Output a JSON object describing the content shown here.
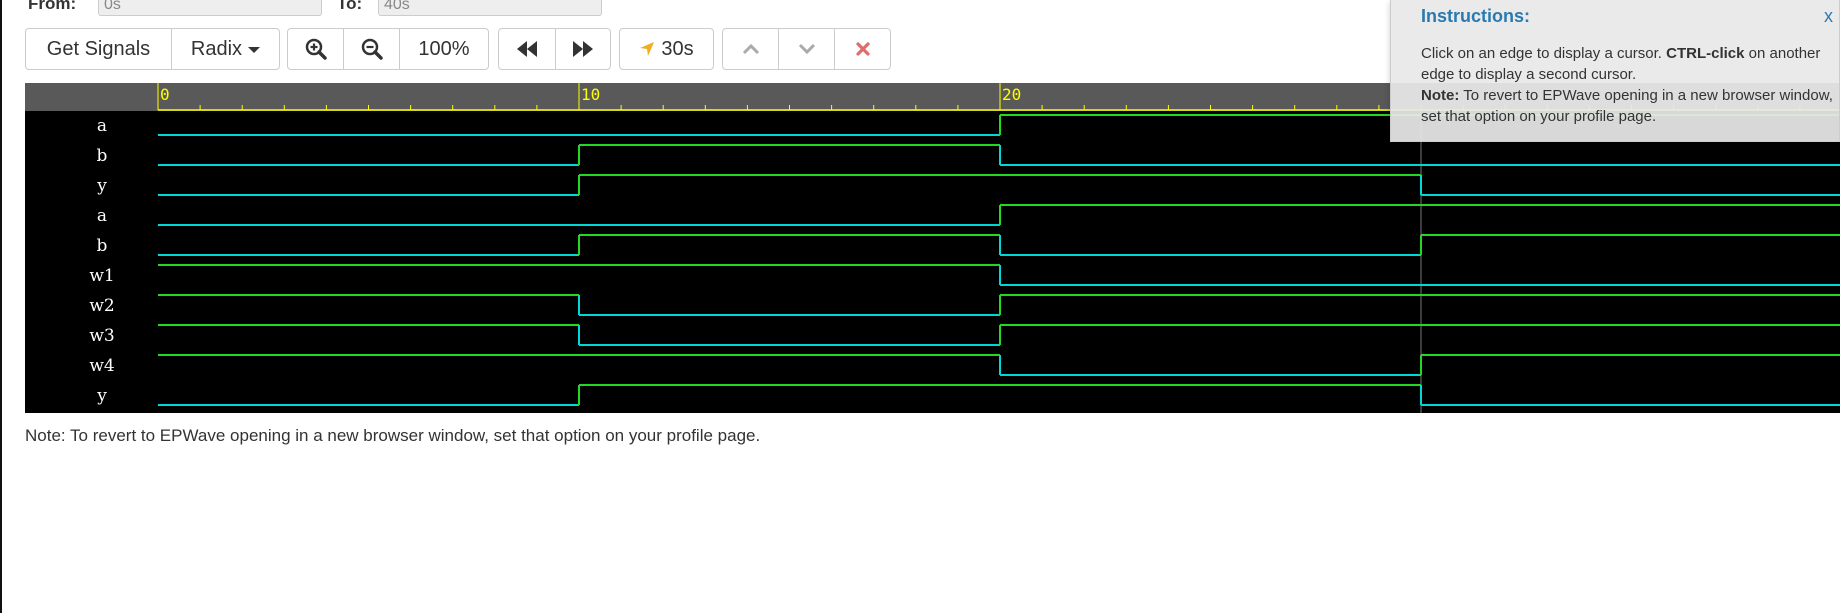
{
  "range": {
    "from_label": "From:",
    "from_value": "0s",
    "to_label": "To:",
    "to_value": "40s"
  },
  "toolbar": {
    "get_signals": "Get Signals",
    "radix": "Radix",
    "zoom": "100%",
    "cursor_time": "30s"
  },
  "timeline": {
    "ticks": [
      {
        "t": 0,
        "label": "0"
      },
      {
        "t": 10,
        "label": "10"
      },
      {
        "t": 20,
        "label": "20"
      }
    ],
    "start": 0,
    "end": 40,
    "minor_step": 1
  },
  "signals": [
    {
      "name": "a",
      "values": [
        0,
        0,
        1,
        1
      ]
    },
    {
      "name": "b",
      "values": [
        0,
        1,
        0,
        0
      ]
    },
    {
      "name": "y",
      "values": [
        0,
        1,
        1,
        0
      ]
    },
    {
      "name": "a",
      "values": [
        0,
        0,
        1,
        1
      ]
    },
    {
      "name": "b",
      "values": [
        0,
        1,
        0,
        1
      ]
    },
    {
      "name": "w1",
      "values": [
        1,
        1,
        0,
        0
      ]
    },
    {
      "name": "w2",
      "values": [
        1,
        0,
        1,
        1
      ]
    },
    {
      "name": "w3",
      "values": [
        1,
        0,
        1,
        1
      ]
    },
    {
      "name": "w4",
      "values": [
        1,
        1,
        0,
        1
      ]
    },
    {
      "name": "y",
      "values": [
        0,
        1,
        1,
        0
      ]
    }
  ],
  "segment_times": [
    0,
    10,
    20,
    30,
    40
  ],
  "colors": {
    "low": "#00d8d8",
    "high": "#22d822",
    "axis": "#ffff00",
    "ruler_bg": "#595959",
    "wave_bg": "#000000"
  },
  "note": "Note: To revert to EPWave opening in a new browser window, set that option on your profile page.",
  "popover": {
    "title": "Instructions:",
    "close": "x",
    "line1_a": "Click on an edge to display a cursor.",
    "line1_b": "CTRL-click",
    "line1_c": "on another edge to display a second cursor.",
    "line2_a": "Note:",
    "line2_b": "To revert to EPWave opening in a new browser window, set that option on your profile page."
  }
}
